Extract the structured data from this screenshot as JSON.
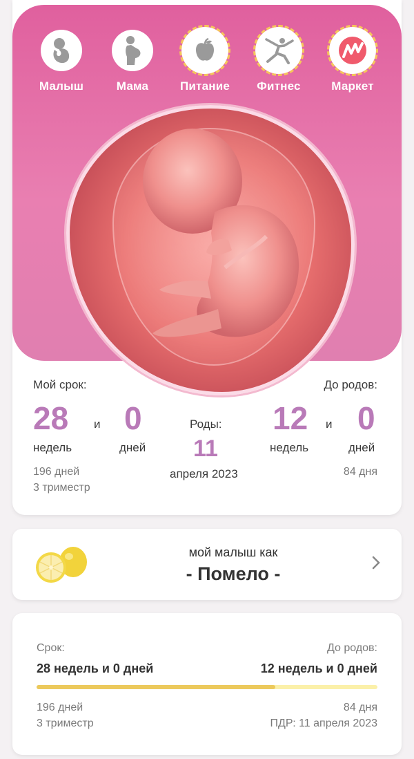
{
  "nav": [
    {
      "label": "Малыш",
      "icon": "baby-icon"
    },
    {
      "label": "Мама",
      "icon": "pregnant-woman-icon"
    },
    {
      "label": "Питание",
      "icon": "apple-icon"
    },
    {
      "label": "Фитнес",
      "icon": "yoga-icon"
    },
    {
      "label": "Маркет",
      "icon": "market-logo-icon"
    }
  ],
  "term": {
    "label": "Мой срок:",
    "weeks": "28",
    "and": "и",
    "days": "0",
    "weeks_unit": "недель",
    "days_unit": "дней",
    "total_days": "196 дней",
    "trimester": "3 триместр"
  },
  "birth": {
    "label": "Роды:",
    "day": "11",
    "month_year": "апреля 2023"
  },
  "until": {
    "label": "До родов:",
    "weeks": "12",
    "and": "и",
    "days": "0",
    "weeks_unit": "недель",
    "days_unit": "дней",
    "total_days": "84 дня"
  },
  "size": {
    "caption": "мой малыш как",
    "fruit": "- Помело -"
  },
  "progress": {
    "term_label": "Срок:",
    "term_value": "28 недель и 0 дней",
    "until_label": "До родов:",
    "until_value": "12 недель и 0 дней",
    "fraction": 0.7,
    "total_days": "196 дней",
    "trimester": "3 триместр",
    "remaining": "84 дня",
    "due_date": "ПДР: 11 апреля 2023"
  },
  "colors": {
    "accent": "#b97ab8",
    "hero": "#e0609e",
    "progress_fill": "#ecc95c",
    "progress_track": "#fbf0a9"
  }
}
